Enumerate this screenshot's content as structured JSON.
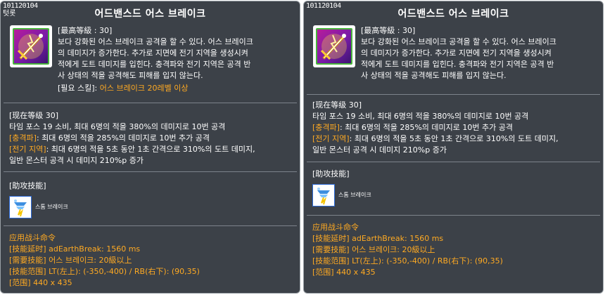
{
  "tooltips": [
    {
      "skill_id": "101120104",
      "corner_tag": "텃롯",
      "title": "어드밴스드 어스 브레이크",
      "desc": {
        "max_level": "[最高等級 : 30]",
        "lines": [
          "보다 강화된 어스 브레이크 공격을 할 수 있다. 어스 브레이크",
          "의 데미지가 증가한다. 추가로 지면에 전기 지역을 생성시켜",
          "적에게 도트 데미지를 입힌다. 충격파와 전기 지역은 공격 반",
          "사 상태의 적을 공격해도 피해를 입지 않는다."
        ],
        "required_label": "[필요 스킬]:",
        "required_value": " 어스 브레이크 20레벨 이상"
      },
      "current": {
        "level_label": "[现在等级 30]",
        "line1": "타임 포스 19 소비, 최대 6명의 적을 380%의 데미지로 10번 공격",
        "shock_label": "[충격파]",
        "shock_text": ": 최대 6명의 적을 285%의 데미지로 10번 추가 공격",
        "elec_label": "[전기 지역]",
        "elec_text": ": 최대 6명의 적을 5초 동안 1초 간격으로 310%의 도트 데미지,",
        "elec_text2": "일반 몬스터 공격 시 데미지 210%p 증가"
      },
      "assist": {
        "header": "[助攻技能]",
        "item_label": "스톰 브레이크",
        "item_icon": "storm-break-icon"
      },
      "combat": {
        "header": "应用战斗命令",
        "delay_label": "[技能延时]",
        "delay_value": " adEarthBreak: 1560 ms",
        "need_label": "[需要技能]",
        "need_value": " 어스 브레이크: 20級以上",
        "range_label": "[技能范围]",
        "range_value": " LT(左上): (-350,-400) / RB(右下): (90,35)",
        "area_label": "[范围]",
        "area_value": " 440 x 435"
      }
    },
    {
      "skill_id": "101120104",
      "corner_tag": "",
      "title": "어드밴스드 어스 브레이크",
      "desc": {
        "max_level": "[最高等級 : 30]",
        "lines": [
          "보다 강화된 어스 브레이크 공격을 할 수 있다. 어스 브레이크",
          "의 데미지가 증가한다. 추가로 지면에 전기 지역을 생성시켜",
          "적에게 도트 데미지를 입힌다. 충격파와 전기 지역은 공격 반",
          "사 상태의 적을 공격해도 피해를 입지 않는다."
        ],
        "required_label": "",
        "required_value": ""
      },
      "current": {
        "level_label": "[现在等级 30]",
        "line1": "타임 포스 19 소비, 최대 6명의 적을 380%의 데미지로 10번 공격",
        "shock_label": "[충격파]",
        "shock_text": ": 최대 6명의 적을 285%의 데미지로 10번 추가 공격",
        "elec_label": "[전기 지역]",
        "elec_text": ": 최대 6명의 적을 5초 동안 1초 간격으로 310%의 도트 데미지,",
        "elec_text2": "일반 몬스터 공격 시 데미지 210%p 증가"
      },
      "assist": {
        "header": "[助攻技能]",
        "item_label": "스톰 브레이크",
        "item_icon": "storm-break-icon"
      },
      "combat": {
        "header": "应用战斗命令",
        "delay_label": "[技能延时]",
        "delay_value": " adEarthBreak: 1560 ms",
        "need_label": "[需要技能]",
        "need_value": " 어스 브레이크: 20級以上",
        "range_label": "[技能范围]",
        "range_value": " LT(左上): (-350,-400) / RB(右下): (90,35)",
        "area_label": "[范围]",
        "area_value": " 440 x 435"
      }
    }
  ],
  "colors": {
    "panel_bg": "#3c4148",
    "highlight": "#ffaa22",
    "text": "#ffffff",
    "icon_frame": "#47b43a"
  },
  "skill_icon": "earth-break-sword-icon"
}
